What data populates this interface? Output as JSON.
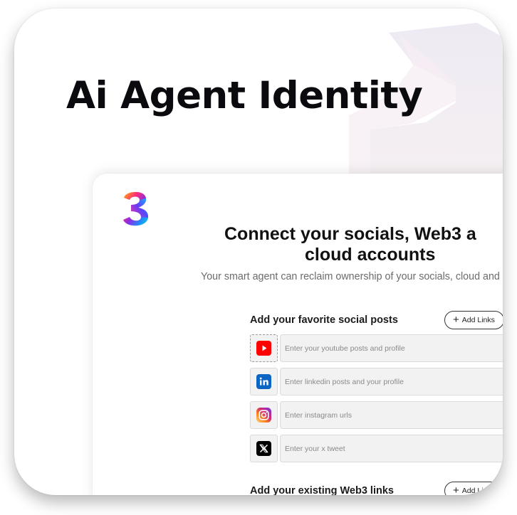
{
  "hero": {
    "title": "Ai Agent Identity"
  },
  "panel": {
    "heading_line1": "Connect your socials, Web3 a",
    "heading_line2": "cloud accounts",
    "subtitle": "Your smart agent can reclaim ownership of your socials, cloud and"
  },
  "social_section": {
    "title": "Add your favorite social posts",
    "add_label": "Add Links",
    "rows": [
      {
        "icon": "youtube-icon",
        "placeholder": "Enter your youtube posts and profile"
      },
      {
        "icon": "linkedin-icon",
        "placeholder": "Enter linkedin posts and your profile"
      },
      {
        "icon": "instagram-icon",
        "placeholder": "Enter instagram urls"
      },
      {
        "icon": "x-icon",
        "placeholder": "Enter your x tweet"
      }
    ]
  },
  "web3_section": {
    "title": "Add your existing Web3 links",
    "add_label": "Add Lin"
  },
  "colors": {
    "youtube": "#ff0000",
    "linkedin": "#0a66c2",
    "x": "#000000",
    "title": "#0b0b0f"
  }
}
